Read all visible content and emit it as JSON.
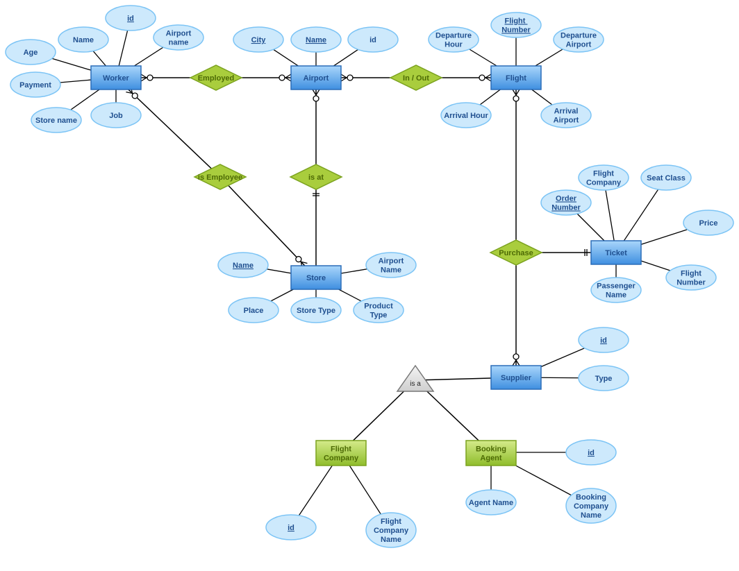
{
  "colors": {
    "entity_text": "#1f4f8f",
    "attribute_fill": "#cde9fc",
    "attribute_stroke": "#7cc4f5",
    "entity_top": "#a9d6fb",
    "entity_bottom": "#3f8fe0",
    "entity_stroke": "#2b6db8",
    "relationship_fill": "#a9cd3d",
    "relationship_stroke": "#7ba21f",
    "relationship_text": "#4d6a05",
    "subtype_top": "#d4ea8a",
    "subtype_bottom": "#8fbd2b",
    "line": "#000000"
  },
  "entities": [
    {
      "id": "worker",
      "label": "Worker"
    },
    {
      "id": "airport",
      "label": "Airport"
    },
    {
      "id": "flight",
      "label": "Flight"
    },
    {
      "id": "store",
      "label": "Store"
    },
    {
      "id": "ticket",
      "label": "Ticket"
    },
    {
      "id": "supplier",
      "label": "Supplier"
    },
    {
      "id": "flight_company",
      "label": "Flight\nCompany",
      "subtype": true
    },
    {
      "id": "booking_agent",
      "label": "Booking\nAgent",
      "subtype": true
    }
  ],
  "relationships": [
    {
      "id": "employed",
      "label": "Employed"
    },
    {
      "id": "inout",
      "label": "In / Out"
    },
    {
      "id": "is_employee",
      "label": "is Employee"
    },
    {
      "id": "is_at",
      "label": "is at"
    },
    {
      "id": "purchase",
      "label": "Purchase"
    }
  ],
  "generalization": {
    "id": "isa",
    "label": "is a"
  },
  "attributes": [
    {
      "id": "w_id",
      "label": "id",
      "key": true,
      "owner": "worker"
    },
    {
      "id": "w_name",
      "label": "Name",
      "owner": "worker"
    },
    {
      "id": "w_airport",
      "label": "Airport\nname",
      "owner": "worker"
    },
    {
      "id": "w_age",
      "label": "Age",
      "owner": "worker"
    },
    {
      "id": "w_payment",
      "label": "Payment",
      "owner": "worker"
    },
    {
      "id": "w_store",
      "label": "Store name",
      "owner": "worker"
    },
    {
      "id": "w_job",
      "label": "Job",
      "owner": "worker"
    },
    {
      "id": "a_city",
      "label": "City",
      "key": true,
      "owner": "airport"
    },
    {
      "id": "a_name",
      "label": "Name",
      "key": true,
      "owner": "airport"
    },
    {
      "id": "a_id",
      "label": "id",
      "owner": "airport"
    },
    {
      "id": "f_number",
      "label": "Flight \nNumber",
      "key": true,
      "owner": "flight"
    },
    {
      "id": "f_dep_hour",
      "label": "Departure\nHour",
      "owner": "flight"
    },
    {
      "id": "f_dep_airport",
      "label": "Departure\nAirport",
      "owner": "flight"
    },
    {
      "id": "f_arr_hour",
      "label": "Arrival Hour",
      "owner": "flight"
    },
    {
      "id": "f_arr_airport",
      "label": "Arrival\nAirport",
      "owner": "flight"
    },
    {
      "id": "t_company",
      "label": "Flight\nCompany",
      "owner": "ticket"
    },
    {
      "id": "t_class",
      "label": "Seat Class",
      "owner": "ticket"
    },
    {
      "id": "t_order",
      "label": "Order\nNumber",
      "key": true,
      "owner": "ticket"
    },
    {
      "id": "t_price",
      "label": "Price",
      "owner": "ticket"
    },
    {
      "id": "t_flight",
      "label": "Flight\nNumber",
      "owner": "ticket"
    },
    {
      "id": "t_passenger",
      "label": "Passenger\nName",
      "owner": "ticket"
    },
    {
      "id": "s_name",
      "label": "Name",
      "key": true,
      "owner": "store"
    },
    {
      "id": "s_airport",
      "label": "Airport\nName",
      "owner": "store"
    },
    {
      "id": "s_place",
      "label": "Place",
      "owner": "store"
    },
    {
      "id": "s_type",
      "label": "Store Type",
      "owner": "store"
    },
    {
      "id": "s_product",
      "label": "Product\nType",
      "owner": "store"
    },
    {
      "id": "sup_id",
      "label": "id",
      "key": true,
      "owner": "supplier"
    },
    {
      "id": "sup_type",
      "label": "Type",
      "owner": "supplier"
    },
    {
      "id": "fc_id",
      "label": "id",
      "key": true,
      "owner": "flight_company"
    },
    {
      "id": "fc_name",
      "label": "Flight\nCompany\nName",
      "owner": "flight_company"
    },
    {
      "id": "ba_id",
      "label": "id",
      "key": true,
      "owner": "booking_agent"
    },
    {
      "id": "ba_name",
      "label": "Agent Name",
      "owner": "booking_agent"
    },
    {
      "id": "ba_company",
      "label": "Booking\nCompany\nName",
      "owner": "booking_agent"
    }
  ],
  "links": [
    {
      "from": "worker",
      "to": "employed",
      "from_marker": "zero-many"
    },
    {
      "from": "employed",
      "to": "airport",
      "to_marker": "zero-many"
    },
    {
      "from": "airport",
      "to": "inout",
      "from_marker": "zero-many"
    },
    {
      "from": "inout",
      "to": "flight",
      "to_marker": "zero-many"
    },
    {
      "from": "worker",
      "to": "is_employee",
      "from_marker": "zero-many"
    },
    {
      "from": "is_employee",
      "to": "store",
      "to_marker": "zero-many"
    },
    {
      "from": "airport",
      "to": "is_at",
      "from_marker": "zero-many"
    },
    {
      "from": "is_at",
      "to": "store",
      "from_marker": "one-one"
    },
    {
      "from": "flight",
      "to": "purchase",
      "from_marker": "zero-many"
    },
    {
      "from": "purchase",
      "to": "ticket",
      "to_marker": "one-one"
    },
    {
      "from": "purchase",
      "to": "supplier",
      "to_marker": "zero-many"
    },
    {
      "from": "isa",
      "to": "supplier"
    },
    {
      "from": "isa",
      "to": "flight_company"
    },
    {
      "from": "isa",
      "to": "booking_agent"
    }
  ]
}
